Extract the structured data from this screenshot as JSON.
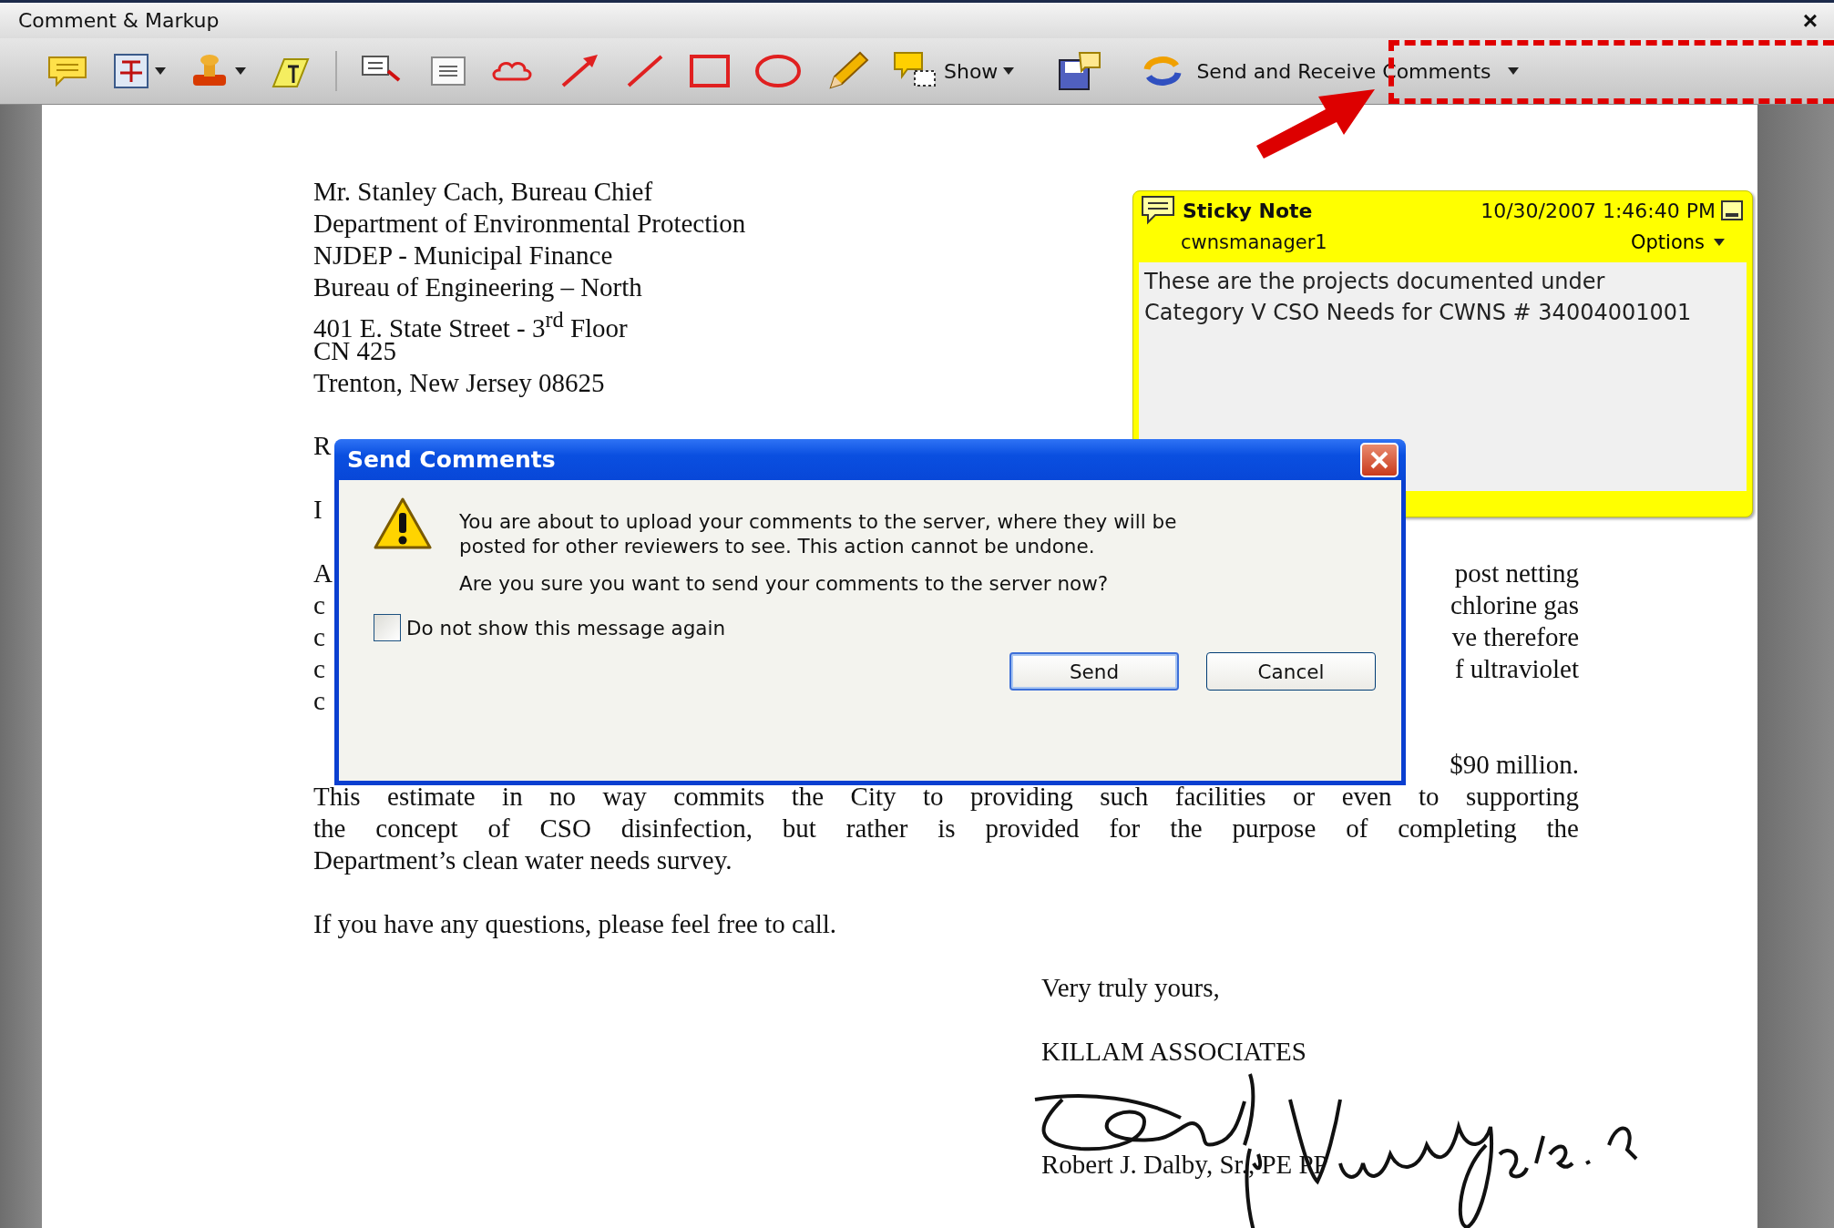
{
  "window": {
    "title": "Comment & Markup",
    "close": "×"
  },
  "toolbar": {
    "show_label": "Show",
    "send_label": "Send and Receive Comments"
  },
  "letter": {
    "address": [
      "Mr. Stanley Cach, Bureau Chief",
      "Department of Environmental Protection",
      "NJDEP - Municipal  Finance",
      "Bureau of Engineering – North",
      "401 E. State Street - 3$^{rd}$ Floor",
      "CN 425",
      "Trenton, New Jersey  08625"
    ],
    "hidden_rows": [
      {
        "left": "R"
      },
      {
        "left": "I"
      },
      {
        "left": "A",
        "right": "post netting"
      },
      {
        "left": "c",
        "right": "chlorine gas"
      },
      {
        "left": "c",
        "right": "ve therefore"
      },
      {
        "left": "c",
        "right": "f ultraviolet"
      },
      {
        "left": "c"
      }
    ],
    "estimate_end": "$90 million.",
    "paragraph": [
      {
        "text": "This estimate in no way commits the City to providing such facilities or even to supporting",
        "kind": "justified"
      },
      {
        "text": "the concept of  CSO disinfection, but rather is provided for the purpose of completing the",
        "kind": "justified"
      },
      {
        "text": "Department’s clean water needs survey.",
        "kind": "last"
      }
    ],
    "questions": "If you have any questions, please feel free to call.",
    "closing": "Very truly yours,",
    "company": "KILLAM ASSOCIATES",
    "signer": "Robert J. Dalby, Sr., PE PP"
  },
  "sticky_note": {
    "title": "Sticky Note",
    "timestamp": "10/30/2007 1:46:40 PM",
    "author": "cwnsmanager1",
    "options": "Options",
    "body": "These are the projects documented under Category V CSO Needs for CWNS # 34004001001"
  },
  "dialog": {
    "title": "Send Comments",
    "message": "You are about to upload your comments to the server, where they will be posted for other reviewers to see. This action cannot be undone.",
    "question": "Are you sure you want to send your comments to the server now?",
    "checkbox": {
      "label": "Do not show this message again",
      "checked": false
    },
    "buttons": [
      {
        "label": "Send",
        "default": true
      },
      {
        "label": "Cancel",
        "default": false
      }
    ]
  }
}
